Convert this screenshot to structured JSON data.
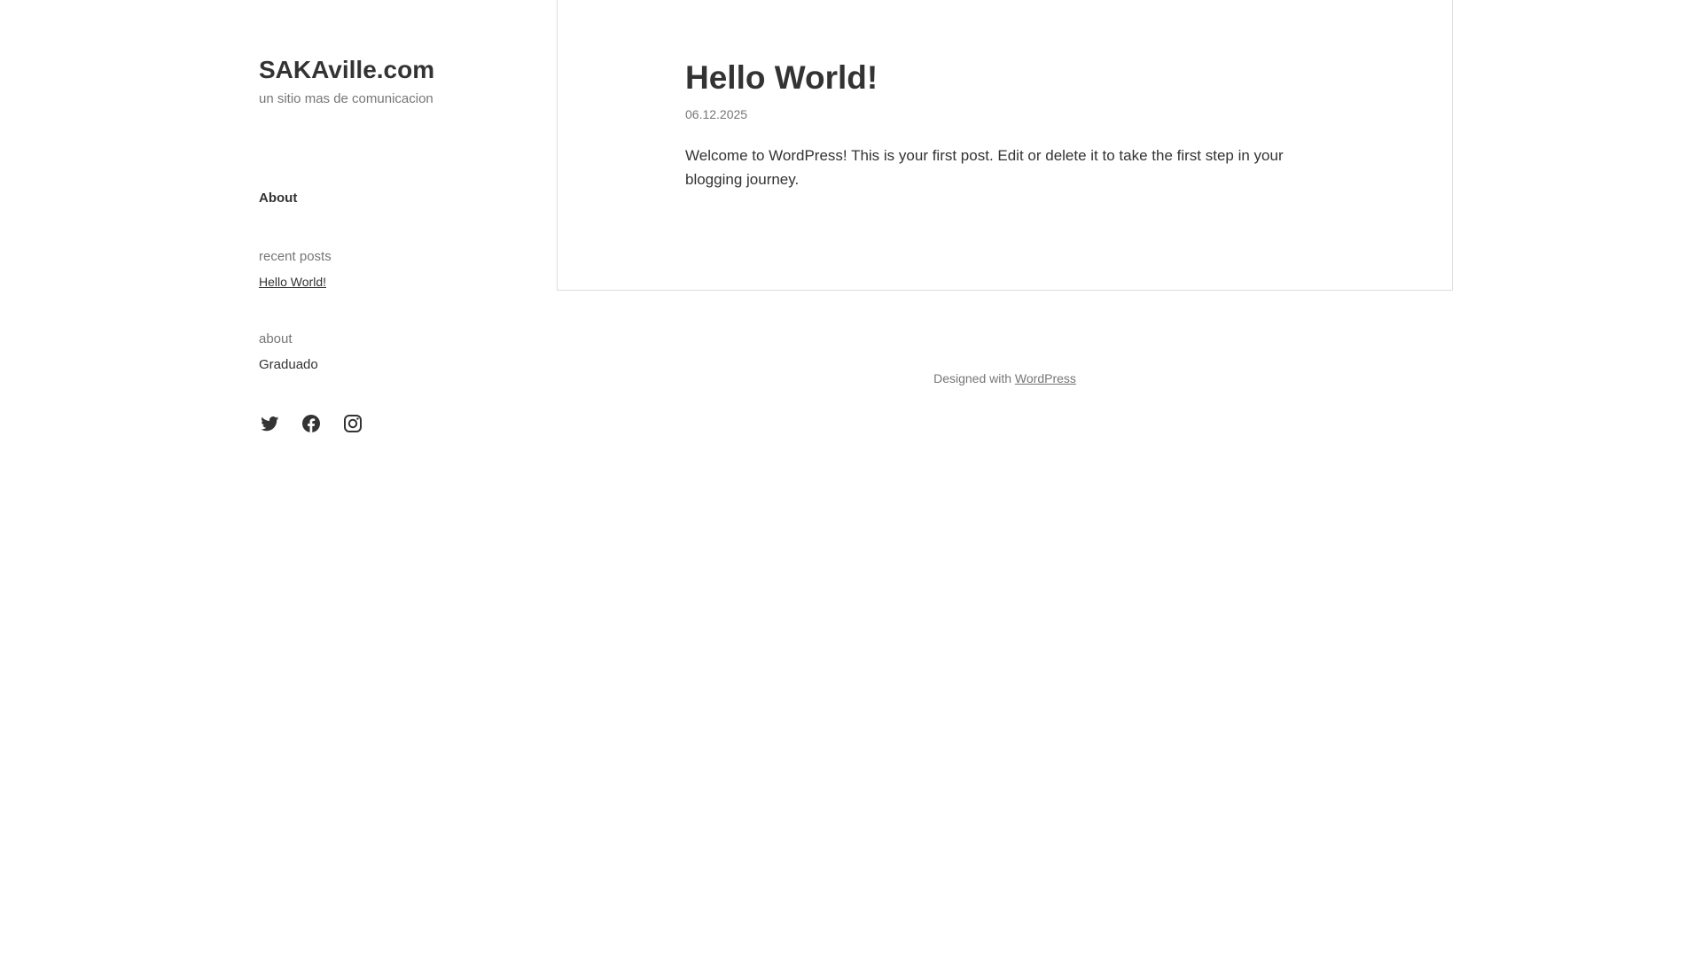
{
  "site": {
    "title": "SAKAville.com",
    "description": "un sitio mas de comunicacion"
  },
  "nav": {
    "about_label": "About"
  },
  "widgets": {
    "recent_posts": {
      "title": "recent posts",
      "items": [
        "Hello World!"
      ]
    },
    "about": {
      "title": "about",
      "text": "Graduado"
    }
  },
  "social": [
    {
      "icon": "twitter-icon"
    },
    {
      "icon": "facebook-icon"
    },
    {
      "icon": "instagram-icon"
    }
  ],
  "post": {
    "title": "Hello World!",
    "date": "06.12.2025",
    "body": "Welcome to WordPress! This is your first post. Edit or delete it to take the first step in your blogging journey."
  },
  "footer": {
    "prefix": "Designed with ",
    "link_label": "WordPress"
  },
  "colors": {
    "text": "#333333",
    "muted": "#767676",
    "border": "#dddddd",
    "background": "#ffffff"
  }
}
